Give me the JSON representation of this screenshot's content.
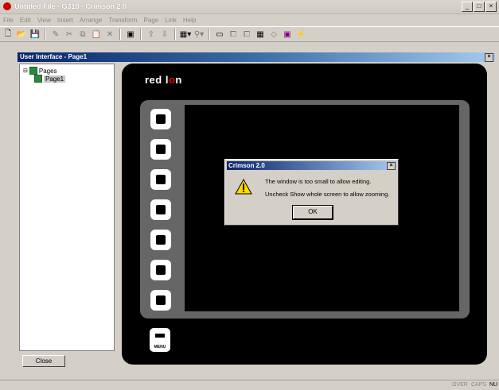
{
  "window": {
    "title": "Untitled File - G310 - Crimson 2.0",
    "controls": [
      "_",
      "□",
      "×"
    ]
  },
  "menus": [
    "File",
    "Edit",
    "View",
    "Insert",
    "Arrange",
    "Transform",
    "Page",
    "Link",
    "Help"
  ],
  "toolbar": {
    "icons": [
      "new-file-icon",
      "open-folder-icon",
      "save-icon",
      "pen-icon",
      "cut-icon",
      "copy-icon",
      "paste-icon",
      "delete-icon",
      "palette-icon",
      "up-arrow-icon",
      "down-arrow-icon",
      "grid-menu-icon",
      "zoom-icon",
      "tile-icon",
      "bring-front-icon",
      "send-back-icon",
      "table-icon",
      "shape-icon",
      "color-icon",
      "lightning-icon"
    ]
  },
  "panel": {
    "title": "User Interface - Page1"
  },
  "tree": {
    "root": "Pages",
    "child": "Page1"
  },
  "close_button": "Close",
  "device": {
    "logo_left": "red l",
    "logo_o": "o",
    "logo_right": "n",
    "menu_key_label": "MENU"
  },
  "dialog": {
    "title": "Crimson 2.0",
    "line1": "The window is too small to allow editing.",
    "line2": "Uncheck Show whole screen to allow zooming.",
    "ok": "OK"
  },
  "status": {
    "over": "OVER",
    "caps": "CAPS",
    "num": "NU"
  }
}
